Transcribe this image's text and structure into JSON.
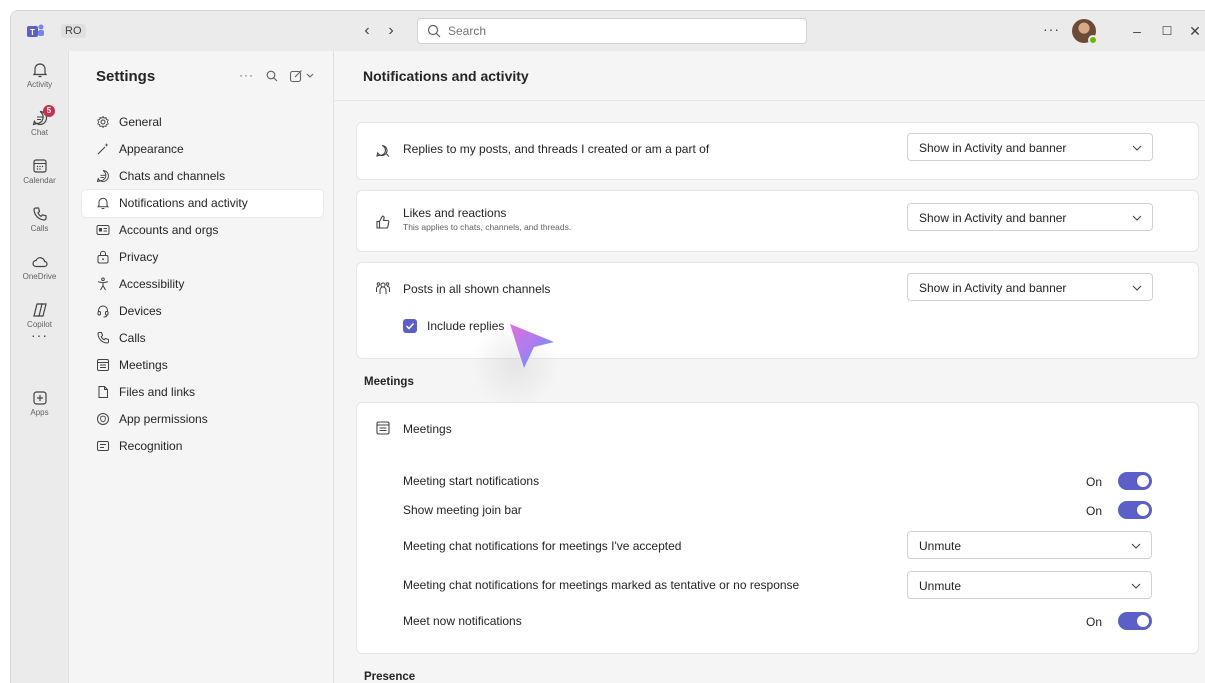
{
  "titlebar": {
    "initials": "RO",
    "back_glyph": "‹",
    "forward_glyph": "›",
    "search_placeholder": "Search",
    "more_glyph": "···",
    "minimize_glyph": "–",
    "maximize_glyph": "☐",
    "close_glyph": "✕"
  },
  "rail": {
    "items": [
      {
        "label": "Activity",
        "icon": "bell-icon"
      },
      {
        "label": "Chat",
        "icon": "chat-icon",
        "badge": "5"
      },
      {
        "label": "Calendar",
        "icon": "calendar-icon"
      },
      {
        "label": "Calls",
        "icon": "phone-icon"
      },
      {
        "label": "OneDrive",
        "icon": "cloud-icon"
      },
      {
        "label": "Copilot",
        "icon": "copilot-icon"
      },
      {
        "label": "Apps",
        "icon": "apps-icon"
      }
    ],
    "more_glyph": "···"
  },
  "sidebar": {
    "title": "Settings",
    "more_glyph": "···",
    "items": [
      {
        "label": "General",
        "icon": "gear-icon"
      },
      {
        "label": "Appearance",
        "icon": "wand-icon"
      },
      {
        "label": "Chats and channels",
        "icon": "chat-icon"
      },
      {
        "label": "Notifications and activity",
        "icon": "bell-icon",
        "active": true
      },
      {
        "label": "Accounts and orgs",
        "icon": "id-card-icon"
      },
      {
        "label": "Privacy",
        "icon": "lock-icon"
      },
      {
        "label": "Accessibility",
        "icon": "accessibility-icon"
      },
      {
        "label": "Devices",
        "icon": "headset-icon"
      },
      {
        "label": "Calls",
        "icon": "phone-icon"
      },
      {
        "label": "Meetings",
        "icon": "calendar-icon"
      },
      {
        "label": "Files and links",
        "icon": "file-icon"
      },
      {
        "label": "App permissions",
        "icon": "shield-icon"
      },
      {
        "label": "Recognition",
        "icon": "badge-icon"
      }
    ]
  },
  "main": {
    "title": "Notifications and activity",
    "replies": {
      "label": "Replies to my posts, and threads I created or am a part of",
      "value": "Show in Activity and banner"
    },
    "likes": {
      "label": "Likes and reactions",
      "sub": "This applies to chats, channels, and threads.",
      "value": "Show in Activity and banner"
    },
    "posts": {
      "label": "Posts in all shown channels",
      "value": "Show in Activity and banner",
      "checkbox_label": "Include replies",
      "checked": true
    },
    "meetings_section": "Meetings",
    "meetings_card_title": "Meetings",
    "meeting_start": {
      "label": "Meeting start notifications",
      "state": "On"
    },
    "join_bar": {
      "label": "Show meeting join bar",
      "state": "On"
    },
    "chat_accepted": {
      "label": "Meeting chat notifications for meetings I've accepted",
      "value": "Unmute"
    },
    "chat_tentative": {
      "label": "Meeting chat notifications for meetings marked as tentative or no response",
      "value": "Unmute"
    },
    "meet_now": {
      "label": "Meet now notifications",
      "state": "On"
    },
    "presence_section": "Presence"
  },
  "colors": {
    "accent": "#5b5fc7",
    "badge": "#c4314b",
    "presence": "#6bb700"
  }
}
